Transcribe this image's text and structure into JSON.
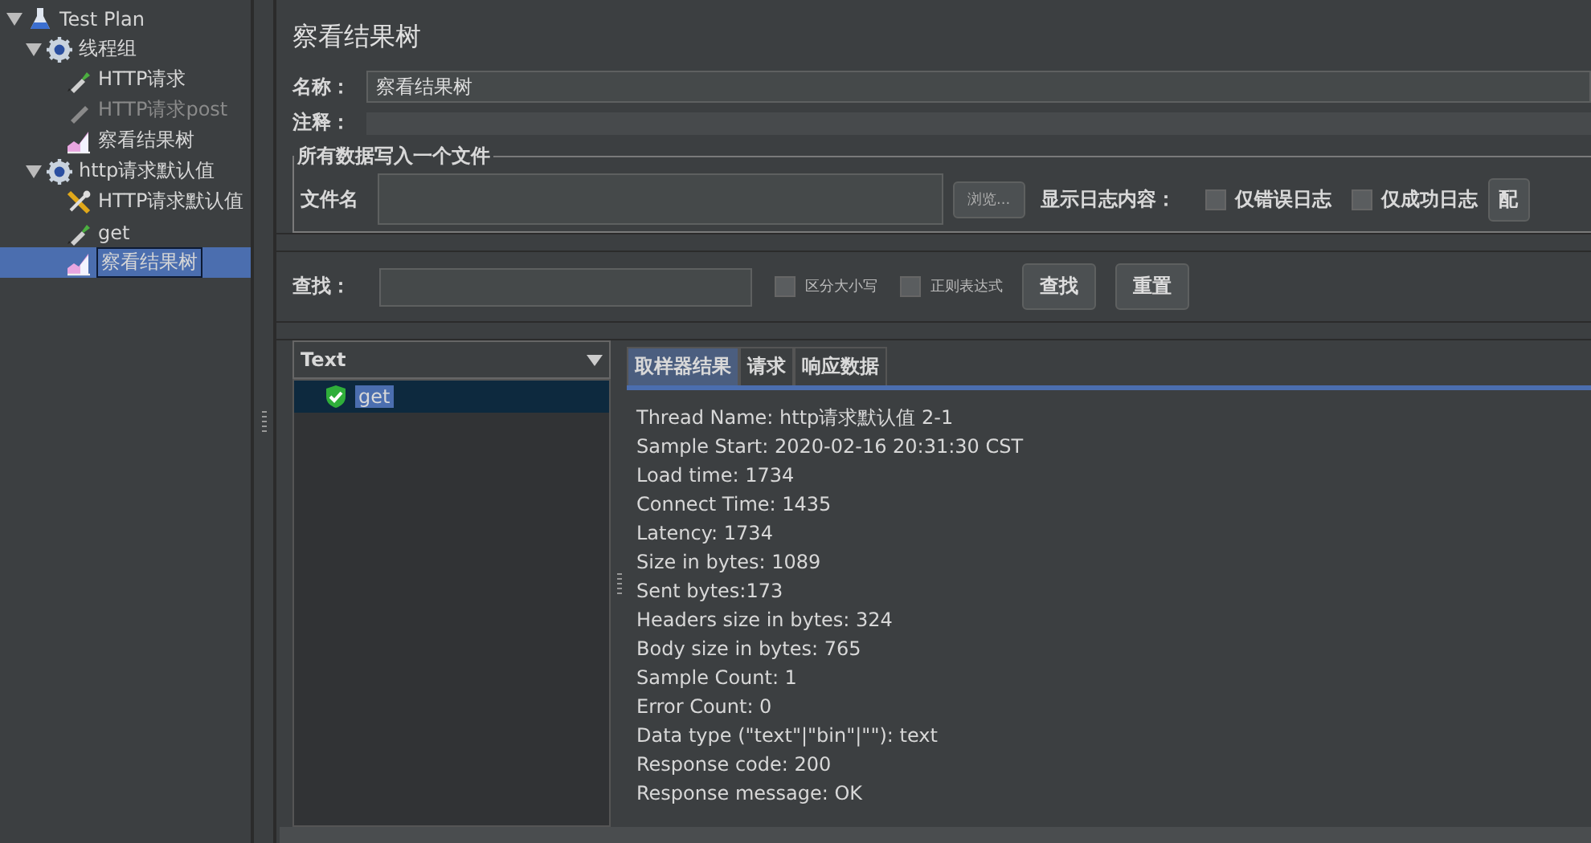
{
  "tree": [
    {
      "label": "Test Plan",
      "kind": "plan",
      "expanded": true,
      "selected": false,
      "disabled": false,
      "children": [
        {
          "label": "线程组",
          "kind": "gear",
          "expanded": true,
          "selected": false,
          "disabled": false,
          "children": [
            {
              "label": "HTTP请求",
              "kind": "sampler",
              "selected": false,
              "disabled": false
            },
            {
              "label": "HTTP请求post",
              "kind": "sampler",
              "selected": false,
              "disabled": true
            },
            {
              "label": "察看结果树",
              "kind": "listener",
              "selected": false,
              "disabled": false
            }
          ]
        },
        {
          "label": "http请求默认值",
          "kind": "gear",
          "expanded": true,
          "selected": false,
          "disabled": false,
          "children": [
            {
              "label": "HTTP请求默认值",
              "kind": "config",
              "selected": false,
              "disabled": false
            },
            {
              "label": "get",
              "kind": "sampler",
              "selected": false,
              "disabled": false
            },
            {
              "label": "察看结果树",
              "kind": "listener",
              "selected": true,
              "disabled": false
            }
          ]
        }
      ]
    }
  ],
  "panel": {
    "title": "察看结果树",
    "name_label": "名称：",
    "name_value": "察看结果树",
    "comment_label": "注释：",
    "file_group": {
      "legend": "所有数据写入一个文件",
      "file_label": "文件名",
      "browse_button": "浏览...",
      "log_label": "显示日志内容：",
      "checkboxes": [
        {
          "label": "仅错误日志",
          "checked": false
        },
        {
          "label": "仅成功日志",
          "checked": false
        }
      ],
      "config_button": "配"
    },
    "search": {
      "label": "查找：",
      "checkboxes": [
        {
          "label": "区分大小写",
          "checked": false
        },
        {
          "label": "正则表达式",
          "checked": false
        }
      ],
      "buttons": [
        "查找",
        "重置"
      ]
    },
    "renderer": "Text",
    "results": [
      {
        "label": "get",
        "success": true,
        "selected": true
      }
    ],
    "tabs": [
      {
        "label": "取样器结果",
        "selected": true
      },
      {
        "label": "请求",
        "selected": false
      },
      {
        "label": "响应数据",
        "selected": false
      }
    ],
    "lines": [
      "Thread Name: http请求默认值 2-1",
      "Sample Start: 2020-02-16 20:31:30 CST",
      "Load time: 1734",
      "Connect Time: 1435",
      "Latency: 1734",
      "Size in bytes: 1089",
      "Sent bytes:173",
      "Headers size in bytes: 324",
      "Body size in bytes: 765",
      "Sample Count: 1",
      "Error Count: 0",
      "Data type (\"text\"|\"bin\"|\"\"): text",
      "Response code: 200",
      "Response message: OK"
    ]
  }
}
